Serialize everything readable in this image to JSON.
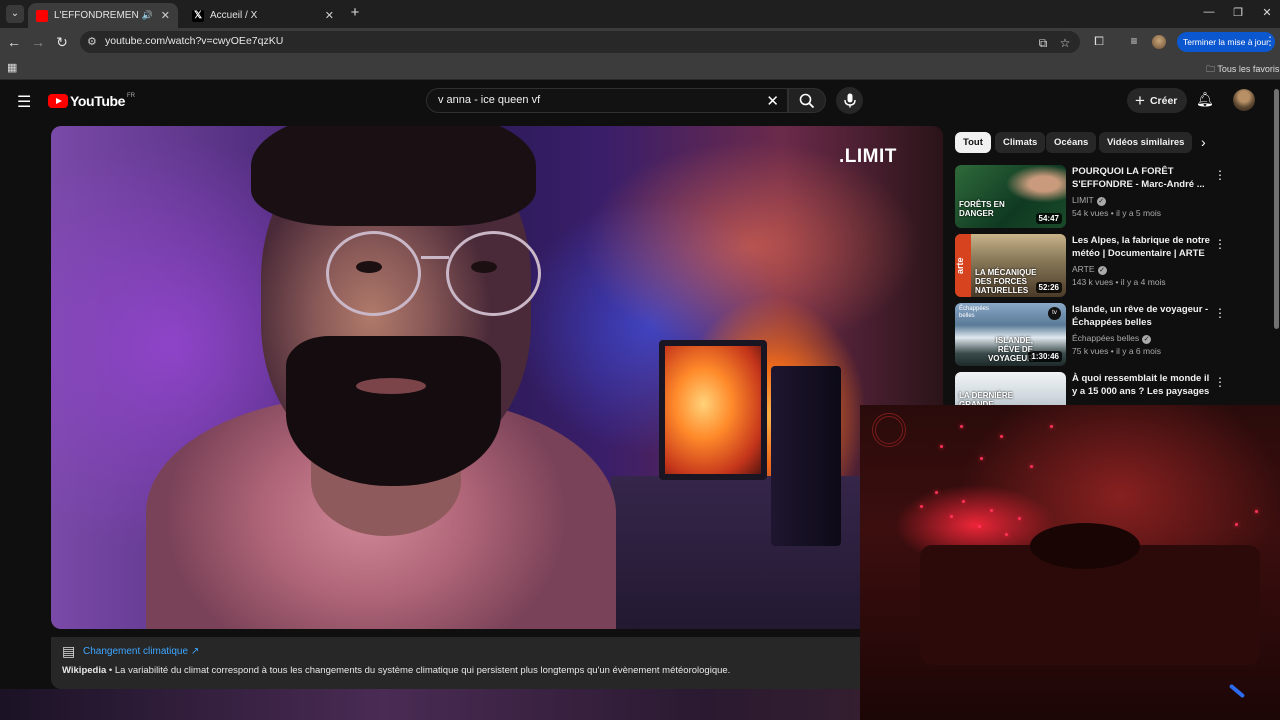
{
  "browser": {
    "tabs": [
      {
        "title": "L'EFFONDREMENT DE L'AM",
        "active": true
      },
      {
        "title": "Accueil / X",
        "active": false
      }
    ],
    "url": "youtube.com/watch?v=cwyOEe7qzKU",
    "update_label": "Terminer la mise à jour",
    "bookmarks_all": "Tous les favoris"
  },
  "youtube": {
    "logo": "YouTube",
    "country_code": "FR",
    "search_query": "v anna - ice queen vf",
    "create_label": "Créer",
    "video": {
      "watermark": ".LIMIT"
    },
    "info_panel": {
      "topic": "Changement climatique",
      "source": "Wikipedia",
      "text": "La variabilité du climat correspond à tous les changements du système climatique qui persistent plus longtemps qu'un évènement météorologique."
    },
    "chips": [
      "Tout",
      "Climats",
      "Océans",
      "Vidéos similaires"
    ],
    "recommendations": [
      {
        "title": "POURQUOI LA FORÊT S'EFFONDRE - Marc-André ...",
        "channel": "LIMIT",
        "meta": "54 k vues • il y a 5 mois",
        "duration": "54:47",
        "overlay": "FORÊTS EN DANGER"
      },
      {
        "title": "Les Alpes, la fabrique de notre météo | Documentaire | ARTE",
        "channel": "ARTE",
        "meta": "143 k vues • il y a 4 mois",
        "duration": "52:26",
        "overlay": "LA MÉCANIQUE DES FORCES NATURELLES",
        "brand": "arte"
      },
      {
        "title": "Islande, un rêve de voyageur - Échappées belles",
        "channel": "Échappées belles",
        "meta": "75 k vues • il y a 6 mois",
        "duration": "1:30:46",
        "overlay": "ISLANDE, RÊVE DE VOYAGEUR",
        "brand": "Échappées belles"
      },
      {
        "title": "À quoi ressemblait le monde il y a 15 000 ans ? Les paysages ...",
        "channel": "",
        "meta": "",
        "duration": "",
        "overlay": "LA DERNIÈRE GRANDE GLACIATION"
      }
    ]
  },
  "colors": {
    "yt_red": "#ff0000",
    "link_blue": "#3ea6ff",
    "update_blue": "#0b57d0"
  }
}
